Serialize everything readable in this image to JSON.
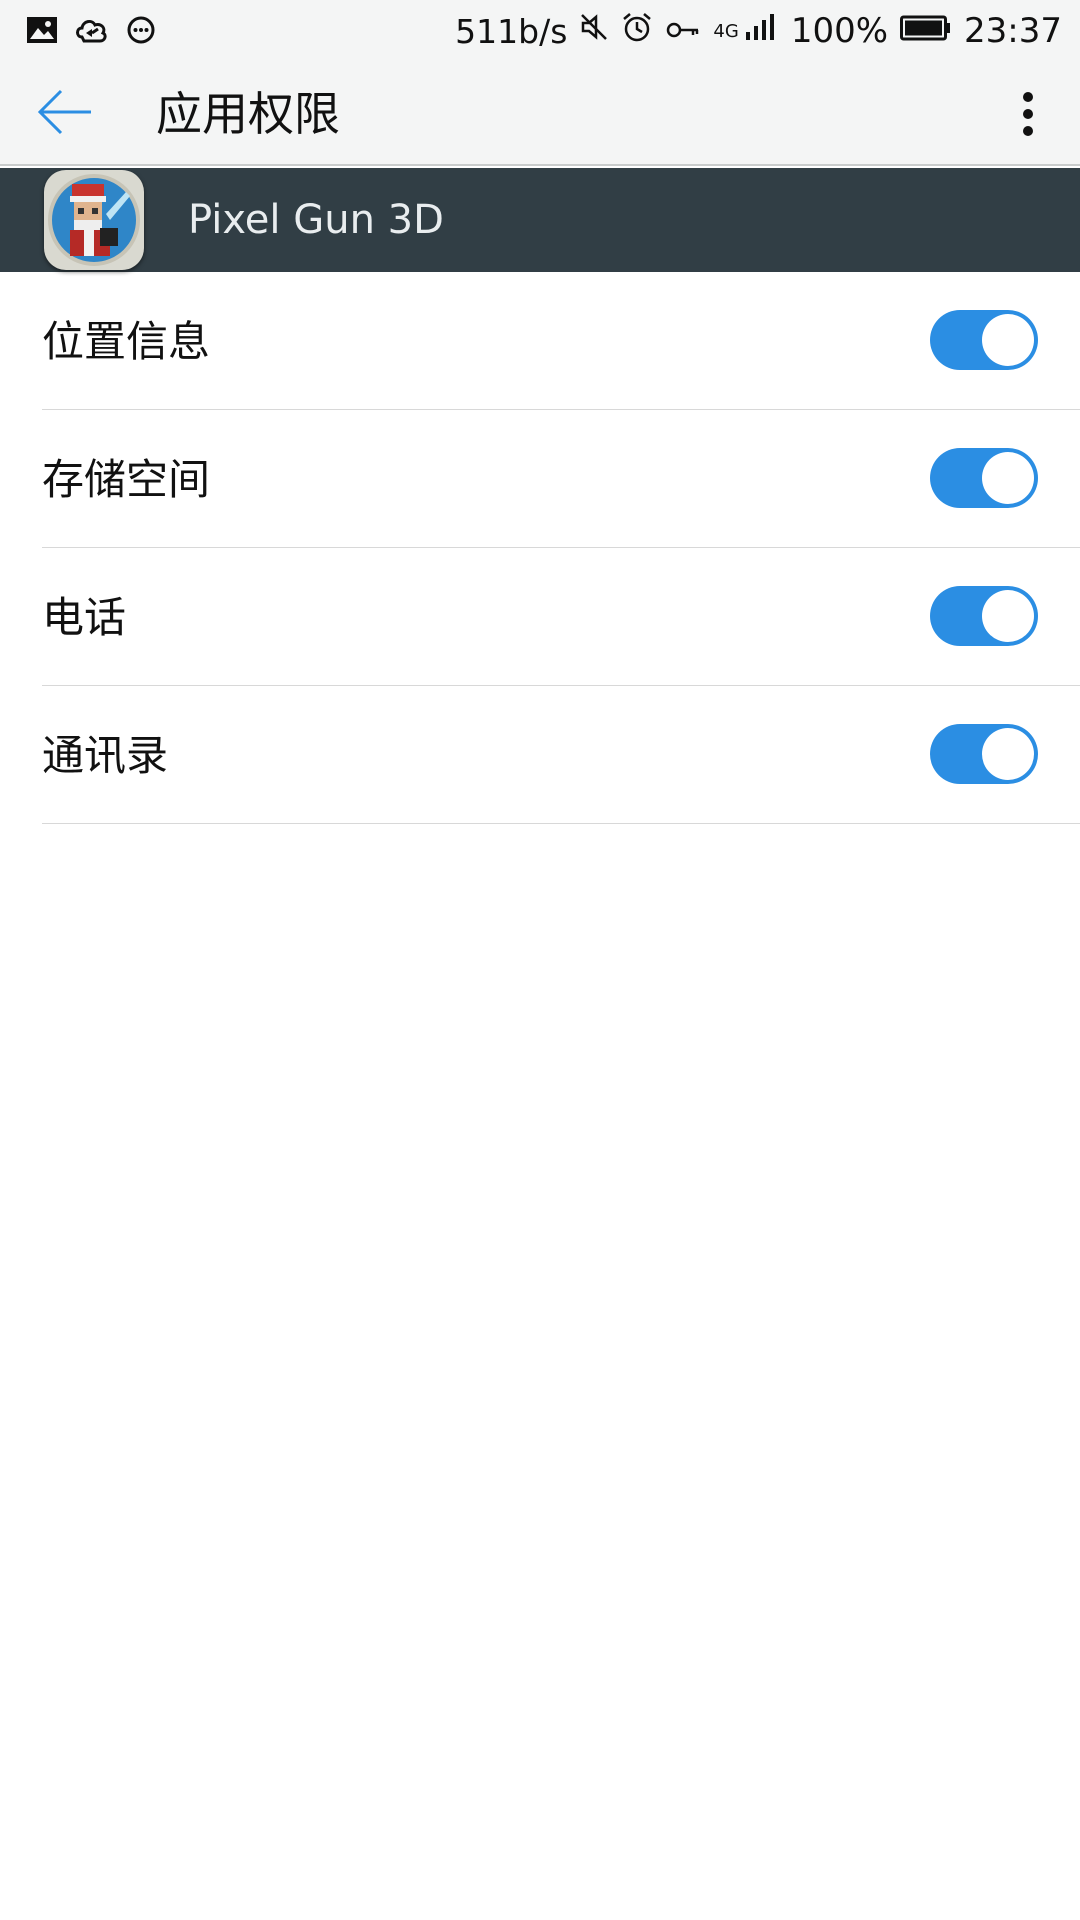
{
  "status_bar": {
    "net_speed": "511b/s",
    "net_type": "4G",
    "battery": "100%",
    "time": "23:37",
    "left_icons": [
      "gallery-icon",
      "cloud-sync-icon",
      "chat-bubble-icon"
    ],
    "right_icons": [
      "mute-icon",
      "alarm-icon",
      "key-icon",
      "signal-icon",
      "battery-icon"
    ]
  },
  "toolbar": {
    "title": "应用权限",
    "back_icon": "arrow-left-icon",
    "more_icon": "more-vertical-icon",
    "accent_color": "#2b8ee3"
  },
  "app": {
    "name": "Pixel Gun 3D",
    "header_color": "#313e45"
  },
  "permissions": [
    {
      "label": "位置信息",
      "enabled": true
    },
    {
      "label": "存储空间",
      "enabled": true
    },
    {
      "label": "电话",
      "enabled": true
    },
    {
      "label": "通讯录",
      "enabled": true
    }
  ]
}
